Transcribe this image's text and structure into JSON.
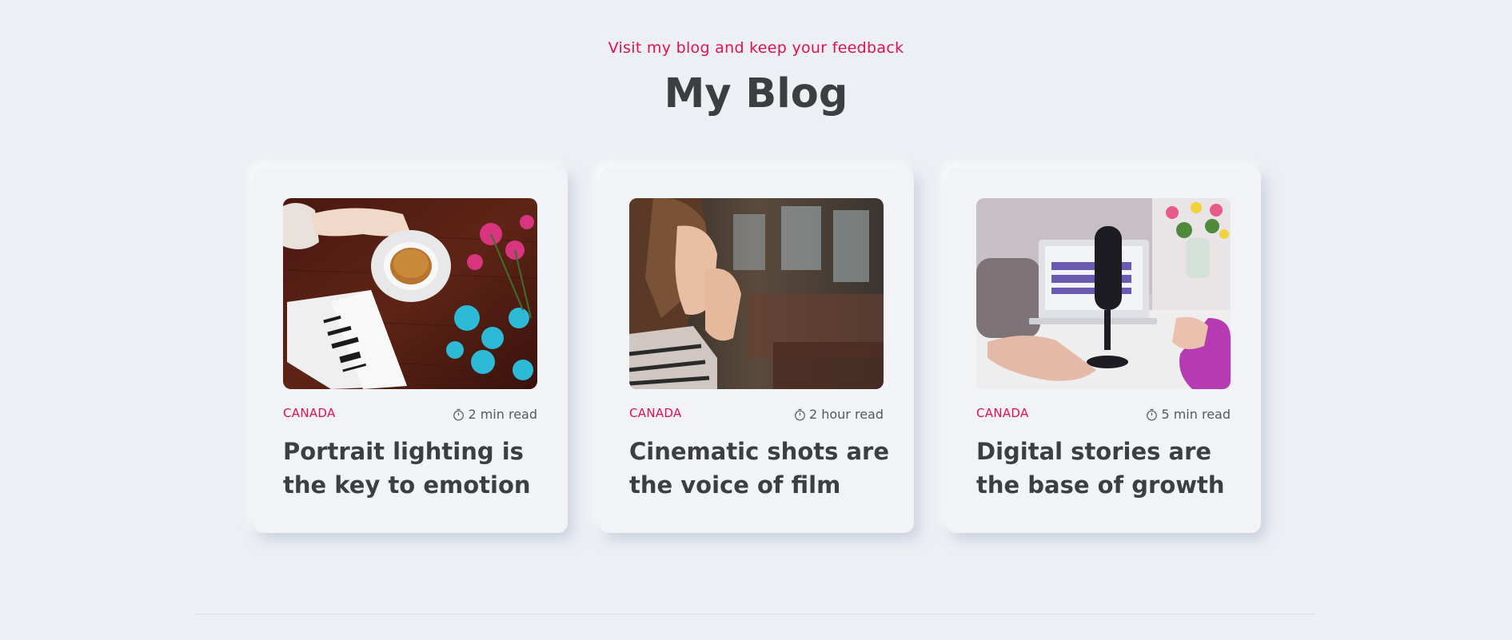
{
  "header": {
    "eyebrow": "Visit my blog and keep your feedback",
    "title": "My Blog"
  },
  "posts": [
    {
      "category": "CANADA",
      "read_time": "2 min read",
      "title": "Portrait lighting is the key to emotion",
      "image": "tea-book-flowers-photo"
    },
    {
      "category": "CANADA",
      "read_time": "2 hour read",
      "title": "Cinematic shots are the voice of film",
      "image": "woman-praying-photo"
    },
    {
      "category": "CANADA",
      "read_time": "5 min read",
      "title": "Digital stories are the base of growth",
      "image": "microphone-laptop-photo"
    }
  ],
  "colors": {
    "background": "#eceff3",
    "accent": "#e4104f",
    "heading": "#3c3e41"
  }
}
